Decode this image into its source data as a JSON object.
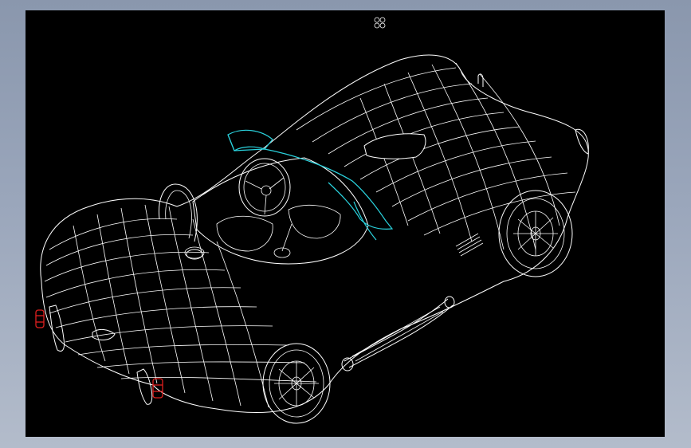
{
  "viewport": {
    "background": "#000000",
    "wireframe_color": "#ffffff",
    "windshield_color": "#2ad3de",
    "taillight_color": "#e0201e"
  },
  "frame": {
    "background": "#9aa6bb"
  },
  "icons": {
    "nav_cube": "view-orientation-icon"
  }
}
